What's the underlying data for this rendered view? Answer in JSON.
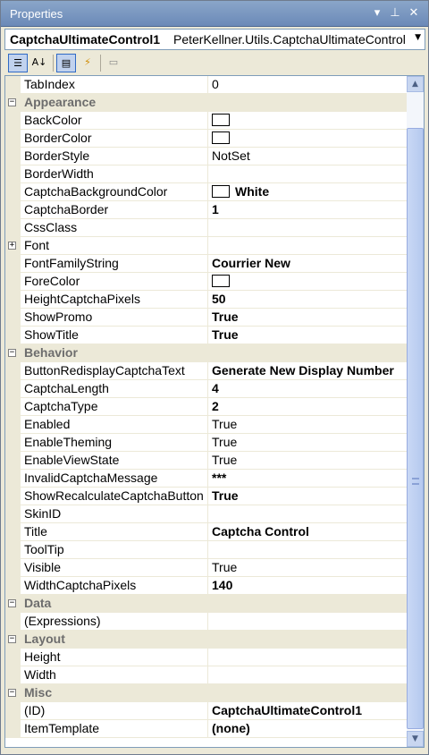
{
  "window": {
    "title": "Properties",
    "pin_glyph": "⊥",
    "close_glyph": "✕",
    "dropdown_glyph": "▾"
  },
  "selector": {
    "object_name": "CaptchaUltimateControl1",
    "object_type": "PeterKellner.Utils.CaptchaUltimateControl"
  },
  "toolbar": {
    "categorized_glyph": "☰",
    "alphabetical_glyph": "A↓",
    "properties_glyph": "▤",
    "events_glyph": "⚡",
    "pages_glyph": "▭"
  },
  "rows": [
    {
      "kind": "prop",
      "name": "TabIndex",
      "value": "0"
    },
    {
      "kind": "cat",
      "name": "Appearance"
    },
    {
      "kind": "prop",
      "name": "BackColor",
      "value": "",
      "swatch": true
    },
    {
      "kind": "prop",
      "name": "BorderColor",
      "value": "",
      "swatch": true
    },
    {
      "kind": "prop",
      "name": "BorderStyle",
      "value": "NotSet"
    },
    {
      "kind": "prop",
      "name": "BorderWidth",
      "value": ""
    },
    {
      "kind": "prop",
      "name": "CaptchaBackgroundColor",
      "value": "White",
      "swatch": true,
      "bold": true
    },
    {
      "kind": "prop",
      "name": "CaptchaBorder",
      "value": "1",
      "bold": true
    },
    {
      "kind": "prop",
      "name": "CssClass",
      "value": ""
    },
    {
      "kind": "propx",
      "name": "Font",
      "value": ""
    },
    {
      "kind": "prop",
      "name": "FontFamilyString",
      "value": "Courrier New",
      "bold": true
    },
    {
      "kind": "prop",
      "name": "ForeColor",
      "value": "",
      "swatch": true
    },
    {
      "kind": "prop",
      "name": "HeightCaptchaPixels",
      "value": "50",
      "bold": true
    },
    {
      "kind": "prop",
      "name": "ShowPromo",
      "value": "True",
      "bold": true
    },
    {
      "kind": "prop",
      "name": "ShowTitle",
      "value": "True",
      "bold": true
    },
    {
      "kind": "cat",
      "name": "Behavior"
    },
    {
      "kind": "prop",
      "name": "ButtonRedisplayCaptchaText",
      "value": "Generate New Display Number",
      "bold": true
    },
    {
      "kind": "prop",
      "name": "CaptchaLength",
      "value": "4",
      "bold": true
    },
    {
      "kind": "prop",
      "name": "CaptchaType",
      "value": "2",
      "bold": true
    },
    {
      "kind": "prop",
      "name": "Enabled",
      "value": "True"
    },
    {
      "kind": "prop",
      "name": "EnableTheming",
      "value": "True"
    },
    {
      "kind": "prop",
      "name": "EnableViewState",
      "value": "True"
    },
    {
      "kind": "prop",
      "name": "InvalidCaptchaMessage",
      "value": "***",
      "bold": true
    },
    {
      "kind": "prop",
      "name": "ShowRecalculateCaptchaButton",
      "value": "True",
      "bold": true
    },
    {
      "kind": "prop",
      "name": "SkinID",
      "value": ""
    },
    {
      "kind": "prop",
      "name": "Title",
      "value": "Captcha Control",
      "bold": true
    },
    {
      "kind": "prop",
      "name": "ToolTip",
      "value": ""
    },
    {
      "kind": "prop",
      "name": "Visible",
      "value": "True"
    },
    {
      "kind": "prop",
      "name": "WidthCaptchaPixels",
      "value": "140",
      "bold": true
    },
    {
      "kind": "cat",
      "name": "Data"
    },
    {
      "kind": "prop",
      "name": "(Expressions)",
      "value": ""
    },
    {
      "kind": "cat",
      "name": "Layout"
    },
    {
      "kind": "prop",
      "name": "Height",
      "value": ""
    },
    {
      "kind": "prop",
      "name": "Width",
      "value": ""
    },
    {
      "kind": "cat",
      "name": "Misc"
    },
    {
      "kind": "prop",
      "name": "(ID)",
      "value": "CaptchaUltimateControl1",
      "bold": true
    },
    {
      "kind": "prop",
      "name": "ItemTemplate",
      "value": "(none)",
      "bold": true
    }
  ],
  "scrollbar": {
    "up_glyph": "▲",
    "down_glyph": "▼"
  }
}
